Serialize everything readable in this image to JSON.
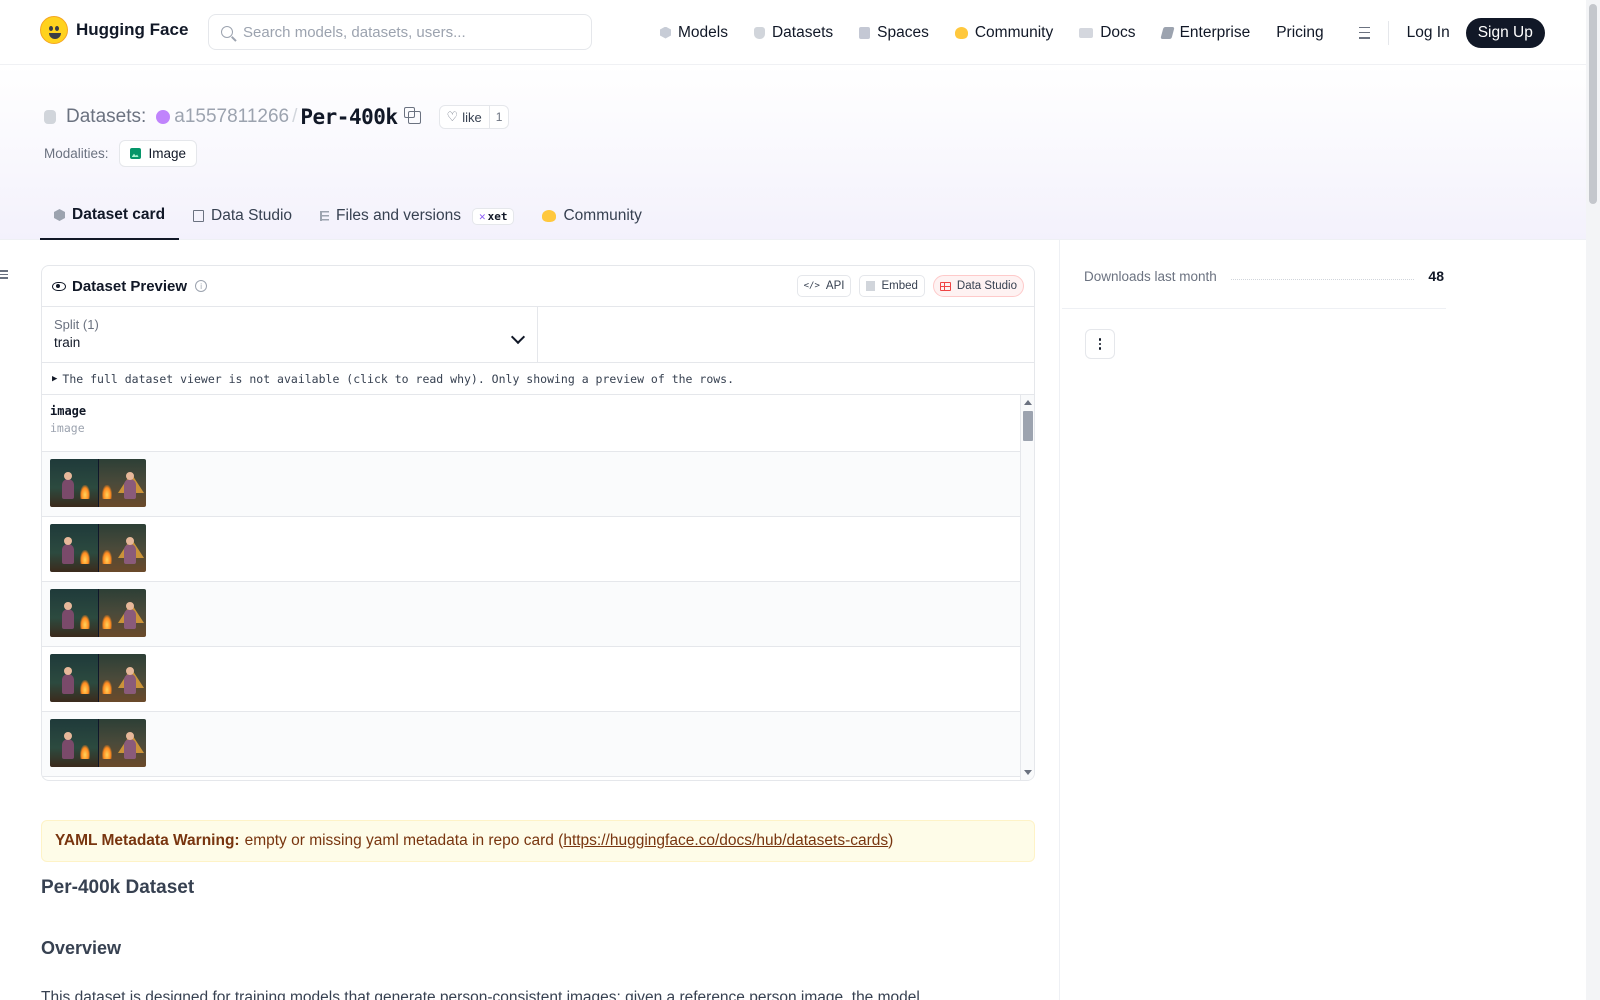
{
  "nav": {
    "brand": "Hugging Face",
    "search_placeholder": "Search models, datasets, users...",
    "items": [
      {
        "label": "Models",
        "icon": "cube-icon"
      },
      {
        "label": "Datasets",
        "icon": "database-icon"
      },
      {
        "label": "Spaces",
        "icon": "spaces-grid-icon"
      },
      {
        "label": "Community",
        "icon": "community-icon"
      },
      {
        "label": "Docs",
        "icon": "book-icon"
      },
      {
        "label": "Enterprise",
        "icon": "enterprise-icon"
      },
      {
        "label": "Pricing"
      }
    ],
    "login": "Log In",
    "signup": "Sign Up"
  },
  "header": {
    "section_label": "Datasets:",
    "owner": "a1557811266",
    "separator": "/",
    "repo": "Per-400k",
    "like_label": "like",
    "like_count": "1",
    "modalities_label": "Modalities:",
    "modality": "Image"
  },
  "tabs": [
    {
      "label": "Dataset card",
      "active": true
    },
    {
      "label": "Data Studio"
    },
    {
      "label": "Files and versions",
      "badge": "xet"
    },
    {
      "label": "Community"
    }
  ],
  "preview": {
    "title": "Dataset Preview",
    "actions": {
      "api": "API",
      "embed": "Embed",
      "data_studio": "Data Studio"
    },
    "split_label": "Split (1)",
    "split_value": "train",
    "notice": "The full dataset viewer is not available (click to read why). Only showing a preview of the rows.",
    "column": {
      "name": "image",
      "type": "image"
    },
    "row_count": 5
  },
  "warning": {
    "title": "YAML Metadata Warning:",
    "text": "empty or missing yaml metadata in repo card (",
    "link": "https://huggingface.co/docs/hub/datasets-cards",
    "suffix": ")"
  },
  "card": {
    "h1": "Per-400k Dataset",
    "h2": "Overview",
    "p": "This dataset is designed for training models that generate person-consistent images: given a reference person image, the model"
  },
  "sidebar": {
    "downloads_label": "Downloads last month",
    "downloads_value": "48"
  },
  "colors": {
    "accent": "#111827",
    "warning_bg": "#fefce8",
    "warning_text": "#78350f",
    "data_studio_btn": "#fef2f2"
  }
}
